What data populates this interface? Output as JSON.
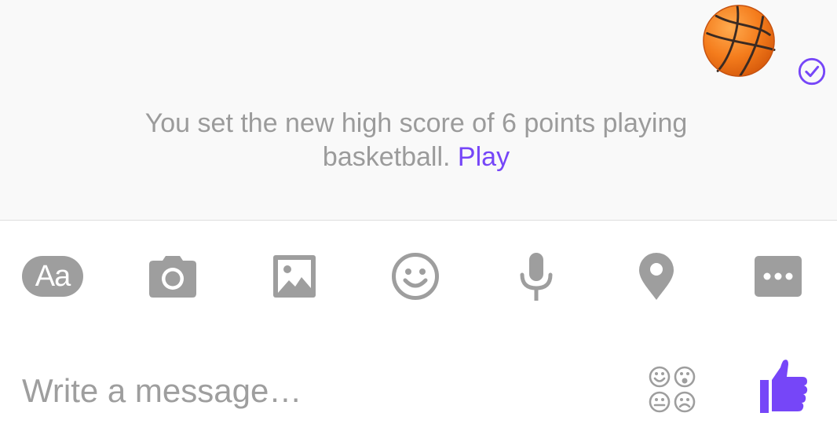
{
  "conversation": {
    "game_message": {
      "text": "You set the new high score of 6 points playing basketball.",
      "link_label": "Play"
    },
    "game_icon": "basketball-icon",
    "seen_status_icon": "check-circle-icon"
  },
  "toolbar": {
    "text_format_label": "Aa",
    "items": [
      {
        "icon": "text-format-icon"
      },
      {
        "icon": "camera-icon"
      },
      {
        "icon": "image-icon"
      },
      {
        "icon": "emoji-icon"
      },
      {
        "icon": "microphone-icon"
      },
      {
        "icon": "location-pin-icon"
      },
      {
        "icon": "more-icon"
      }
    ]
  },
  "composer": {
    "placeholder": "Write a message…",
    "value": "",
    "sticker_icon": "stickers-icon",
    "send_icon": "thumbs-up-icon"
  },
  "colors": {
    "accent": "#7646f8",
    "icon_gray": "#9e9e9e",
    "text_gray": "#9b9b9b",
    "chat_background": "#f9f9f9",
    "basketball": "#f57e20"
  }
}
